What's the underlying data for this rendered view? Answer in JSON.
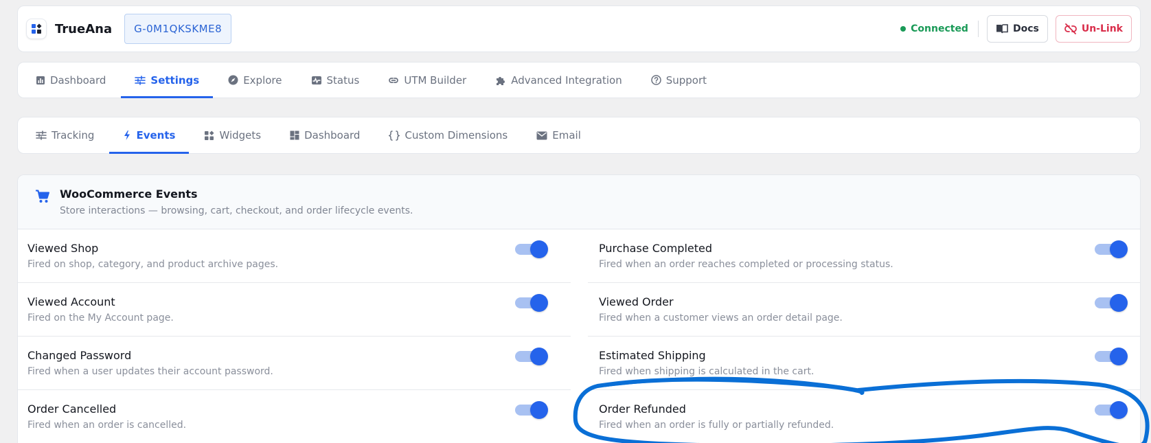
{
  "header": {
    "brand": "TrueAna",
    "measurement_id": "G-0M1QKSKME8",
    "status": "Connected",
    "docs_label": "Docs",
    "unlink_label": "Un-Link",
    "colors": {
      "accent": "#2563eb",
      "connected": "#1a9a57",
      "unlink": "#d92d4a"
    }
  },
  "main_nav": {
    "tabs": [
      {
        "label": "Dashboard",
        "icon": "bar-chart-icon"
      },
      {
        "label": "Settings",
        "icon": "sliders-icon",
        "active": true
      },
      {
        "label": "Explore",
        "icon": "compass-icon"
      },
      {
        "label": "Status",
        "icon": "pulse-icon"
      },
      {
        "label": "UTM Builder",
        "icon": "link-icon"
      },
      {
        "label": "Advanced Integration",
        "icon": "puzzle-icon"
      },
      {
        "label": "Support",
        "icon": "help-circle-icon"
      }
    ]
  },
  "sub_nav": {
    "tabs": [
      {
        "label": "Tracking",
        "icon": "sliders-icon"
      },
      {
        "label": "Events",
        "icon": "bolt-icon",
        "active": true
      },
      {
        "label": "Widgets",
        "icon": "widgets-icon"
      },
      {
        "label": "Dashboard",
        "icon": "dashboard-grid-icon"
      },
      {
        "label": "Custom Dimensions",
        "icon": "braces-icon"
      },
      {
        "label": "Email",
        "icon": "mail-icon"
      }
    ]
  },
  "events_section": {
    "title": "WooCommerce Events",
    "description": "Store interactions — browsing, cart, checkout, and order lifecycle events.",
    "icon": "cart-icon",
    "events": [
      {
        "title": "Viewed Shop",
        "description": "Fired on shop, category, and product archive pages.",
        "enabled": true
      },
      {
        "title": "Purchase Completed",
        "description": "Fired when an order reaches completed or processing status.",
        "enabled": true
      },
      {
        "title": "Viewed Account",
        "description": "Fired on the My Account page.",
        "enabled": true
      },
      {
        "title": "Viewed Order",
        "description": "Fired when a customer views an order detail page.",
        "enabled": true
      },
      {
        "title": "Changed Password",
        "description": "Fired when a user updates their account password.",
        "enabled": true
      },
      {
        "title": "Estimated Shipping",
        "description": "Fired when shipping is calculated in the cart.",
        "enabled": true
      },
      {
        "title": "Order Cancelled",
        "description": "Fired when an order is cancelled.",
        "enabled": true
      },
      {
        "title": "Order Refunded",
        "description": "Fired when an order is fully or partially refunded.",
        "enabled": true
      }
    ]
  },
  "annotation": {
    "shape": "hand-drawn-ellipse",
    "target": "Order Refunded",
    "color": "#0a6fd6"
  }
}
